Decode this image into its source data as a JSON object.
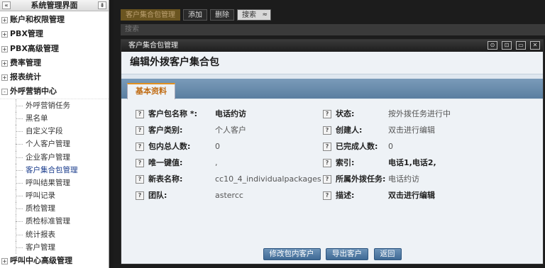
{
  "sidebar": {
    "title": "系统管理界面",
    "collapse_glyph": "«",
    "pin_glyph": "⇟",
    "nodes": [
      {
        "label": "账户和权限管理",
        "toggle": "+"
      },
      {
        "label": "PBX管理",
        "toggle": "+"
      },
      {
        "label": "PBX高级管理",
        "toggle": "+"
      },
      {
        "label": "费率管理",
        "toggle": "+"
      },
      {
        "label": "报表统计",
        "toggle": "+"
      },
      {
        "label": "外呼营销中心",
        "toggle": "-"
      },
      {
        "label": "呼叫中心高级管理",
        "toggle": "+"
      }
    ],
    "children": [
      "外呼营销任务",
      "黑名单",
      "自定义字段",
      "个人客户管理",
      "企业客户管理",
      "客户集合包管理",
      "呼叫结果管理",
      "呼叫记录",
      "质检管理",
      "质检标准管理",
      "统计报表",
      "客户管理"
    ]
  },
  "toolbar": {
    "tab_current": "客户集合包管理",
    "add": "添加",
    "delete": "删除",
    "search": "搜索",
    "search_arrow": "≈",
    "strip_label": "搜索"
  },
  "modal": {
    "title": "客户集合包管理",
    "controls": [
      "⊙",
      "⊡",
      "▭",
      "✕"
    ],
    "form_title": "编辑外拨客户集合包",
    "tab_basic": "基本资料",
    "help_glyph": "?",
    "fields": {
      "package_name": {
        "label": "客户包名称 *:",
        "value": "电话约访"
      },
      "status": {
        "label": "状态:",
        "value": "按外拨任务进行中"
      },
      "customer_type": {
        "label": "客户类别:",
        "value": "个人客户"
      },
      "creator": {
        "label": "创建人:",
        "value": "双击进行编辑"
      },
      "total": {
        "label": "包内总人数:",
        "value": "0"
      },
      "completed": {
        "label": "已完成人数:",
        "value": "0"
      },
      "unique_value": {
        "label": "唯一键值:",
        "value": ","
      },
      "index": {
        "label": "索引:",
        "value": "电话1,电话2,"
      },
      "new_table": {
        "label": "新表名称:",
        "value": "cc10_4_individualpackages"
      },
      "task": {
        "label": "所属外拨任务:",
        "value": "电话约访"
      },
      "team": {
        "label": "团队:",
        "value": "astercc"
      },
      "description": {
        "label": "描述:",
        "value": "双击进行编辑"
      }
    },
    "buttons": {
      "edit_customers": "修改包内客户",
      "export": "导出客户",
      "back": "返回"
    }
  }
}
